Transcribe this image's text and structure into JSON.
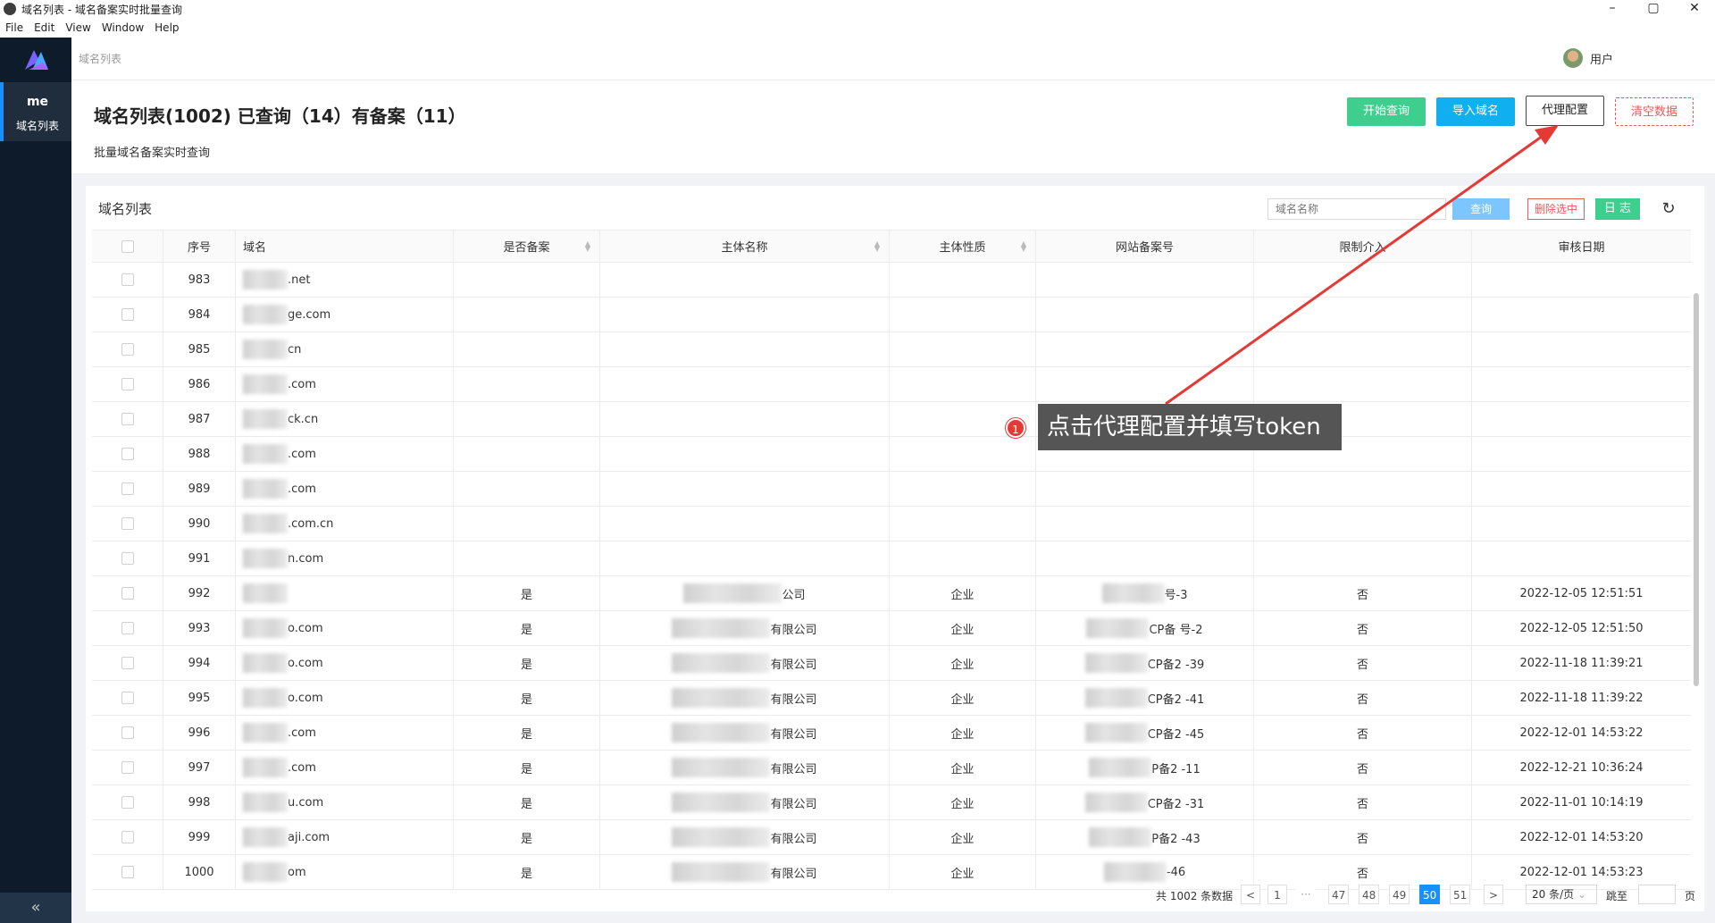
{
  "window": {
    "title": "域名列表 - 域名备案实时批量查询",
    "controls": [
      "–",
      "▢",
      "✕"
    ]
  },
  "menu": [
    "File",
    "Edit",
    "View",
    "Window",
    "Help"
  ],
  "sidebar": {
    "item_line1": "me",
    "item_line2": "域名列表",
    "collapse": "«"
  },
  "header": {
    "breadcrumb": "域名列表",
    "user": "用户"
  },
  "page": {
    "title": "域名列表(1002) 已查询（14）有备案（11）",
    "subtitle": "批量域名备案实时查询",
    "buttons": {
      "start": "开始查询",
      "import": "导入域名",
      "proxy": "代理配置",
      "clear": "清空数据"
    }
  },
  "card": {
    "title": "域名列表",
    "search_placeholder": "域名名称",
    "query": "查询",
    "delete": "删除选中",
    "log": "日 志",
    "refresh": "↻"
  },
  "table": {
    "headers": [
      "序号",
      "域名",
      "是否备案",
      "主体名称",
      "主体性质",
      "网站备案号",
      "限制介入",
      "审核日期"
    ],
    "rows": [
      {
        "seq": "983",
        "domain": ".net",
        "rec": "",
        "subject": "",
        "nature": "",
        "icp": "",
        "limit": "",
        "date": ""
      },
      {
        "seq": "984",
        "domain": "ge.com",
        "rec": "",
        "subject": "",
        "nature": "",
        "icp": "",
        "limit": "",
        "date": ""
      },
      {
        "seq": "985",
        "domain": "cn",
        "rec": "",
        "subject": "",
        "nature": "",
        "icp": "",
        "limit": "",
        "date": ""
      },
      {
        "seq": "986",
        "domain": ".com",
        "rec": "",
        "subject": "",
        "nature": "",
        "icp": "",
        "limit": "",
        "date": ""
      },
      {
        "seq": "987",
        "domain": "ck.cn",
        "rec": "",
        "subject": "",
        "nature": "",
        "icp": "",
        "limit": "",
        "date": ""
      },
      {
        "seq": "988",
        "domain": ".com",
        "rec": "",
        "subject": "",
        "nature": "",
        "icp": "",
        "limit": "",
        "date": ""
      },
      {
        "seq": "989",
        "domain": ".com",
        "rec": "",
        "subject": "",
        "nature": "",
        "icp": "",
        "limit": "",
        "date": ""
      },
      {
        "seq": "990",
        "domain": ".com.cn",
        "rec": "",
        "subject": "",
        "nature": "",
        "icp": "",
        "limit": "",
        "date": ""
      },
      {
        "seq": "991",
        "domain": "n.com",
        "rec": "",
        "subject": "",
        "nature": "",
        "icp": "",
        "limit": "",
        "date": ""
      },
      {
        "seq": "992",
        "domain": "",
        "rec": "是",
        "subject": "公司",
        "nature": "企业",
        "icp": "号-3",
        "limit": "否",
        "date": "2022-12-05 12:51:51"
      },
      {
        "seq": "993",
        "domain": "o.com",
        "rec": "是",
        "subject": "有限公司",
        "nature": "企业",
        "icp": "CP备 号-2",
        "limit": "否",
        "date": "2022-12-05 12:51:50"
      },
      {
        "seq": "994",
        "domain": "o.com",
        "rec": "是",
        "subject": "有限公司",
        "nature": "企业",
        "icp": "CP备2 -39",
        "limit": "否",
        "date": "2022-11-18 11:39:21"
      },
      {
        "seq": "995",
        "domain": "o.com",
        "rec": "是",
        "subject": "有限公司",
        "nature": "企业",
        "icp": "CP备2 -41",
        "limit": "否",
        "date": "2022-11-18 11:39:22"
      },
      {
        "seq": "996",
        "domain": ".com",
        "rec": "是",
        "subject": "有限公司",
        "nature": "企业",
        "icp": "CP备2 -45",
        "limit": "否",
        "date": "2022-12-01 14:53:22"
      },
      {
        "seq": "997",
        "domain": ".com",
        "rec": "是",
        "subject": "有限公司",
        "nature": "企业",
        "icp": "P备2 -11",
        "limit": "否",
        "date": "2022-12-21 10:36:24"
      },
      {
        "seq": "998",
        "domain": "u.com",
        "rec": "是",
        "subject": "有限公司",
        "nature": "企业",
        "icp": "CP备2 -31",
        "limit": "否",
        "date": "2022-11-01 10:14:19"
      },
      {
        "seq": "999",
        "domain": "aji.com",
        "rec": "是",
        "subject": "有限公司",
        "nature": "企业",
        "icp": "P备2 -43",
        "limit": "否",
        "date": "2022-12-01 14:53:20"
      },
      {
        "seq": "1000",
        "domain": "om",
        "rec": "是",
        "subject": "有限公司",
        "nature": "企业",
        "icp": "-46",
        "limit": "否",
        "date": "2022-12-01 14:53:23"
      }
    ]
  },
  "pagination": {
    "total": "共 1002 条数据",
    "prev": "<",
    "pages": [
      "1",
      "···",
      "47",
      "48",
      "49",
      "50",
      "51"
    ],
    "active": "50",
    "next": ">",
    "page_size": "20 条/页",
    "jump": "跳至",
    "page_unit": "页"
  },
  "annotation": {
    "badge": "1",
    "text": "点击代理配置并填写token"
  }
}
